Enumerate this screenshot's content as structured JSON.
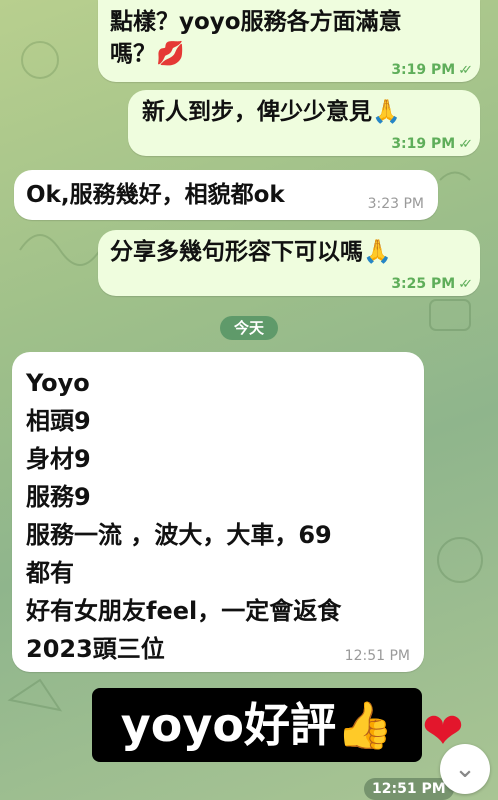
{
  "messages": [
    {
      "lines": [
        "點樣？yoyo服務各方面滿意",
        "嗎？💋"
      ],
      "time": "3:19 PM"
    },
    {
      "lines": [
        "新人到步，俾少少意見🙏"
      ],
      "time": "3:19 PM"
    },
    {
      "lines": [
        "Ok,服務幾好，相貌都ok"
      ],
      "time": "3:23 PM"
    },
    {
      "lines": [
        "分享多幾句形容下可以嗎🙏"
      ],
      "time": "3:25 PM"
    }
  ],
  "day_separator": "今天",
  "review": {
    "lines": [
      "Yoyo",
      "相頭9",
      "身材9",
      "服務9",
      "服務一流 ，波大，大車，69",
      "都有",
      "好有女朋友feel，一定會返食",
      "2023頭三位"
    ],
    "time": "12:51 PM"
  },
  "sticker": {
    "text": "yoyo好評👍",
    "heart": "❤",
    "time": "12:51 PM"
  },
  "colors": {
    "outgoing": "#effdde",
    "incoming": "#ffffff",
    "read_check": "#5fae5a"
  }
}
